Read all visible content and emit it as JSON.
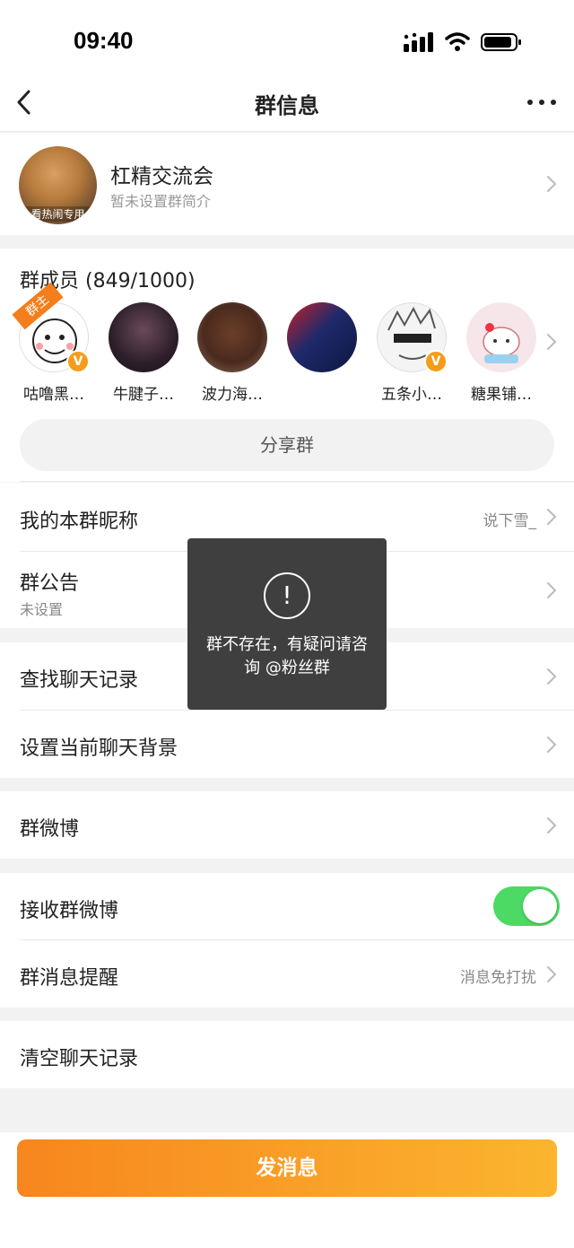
{
  "status_bar": {
    "time": "09:40"
  },
  "nav": {
    "title": "群信息"
  },
  "group": {
    "name": "杠精交流会",
    "description": "暂未设置群简介",
    "avatar_caption": "看热闹专用"
  },
  "members": {
    "title": "群成员 (849/1000)",
    "owner_tag": "群主",
    "list": [
      {
        "name": "咕噜黑…",
        "verified": true
      },
      {
        "name": "牛腱子…",
        "verified": false
      },
      {
        "name": "波力海…",
        "verified": false
      },
      {
        "name": "",
        "verified": false
      },
      {
        "name": "五条小…",
        "verified": true
      },
      {
        "name": "糖果铺…",
        "verified": false
      }
    ],
    "verified_badge": "V",
    "share_label": "分享群"
  },
  "rows": {
    "nickname": {
      "label": "我的本群昵称",
      "value": "说下雪_"
    },
    "notice": {
      "label": "群公告",
      "sub": "未设置"
    },
    "search_history": {
      "label": "查找聊天记录"
    },
    "background": {
      "label": "设置当前聊天背景"
    },
    "group_weibo": {
      "label": "群微博"
    },
    "receive_weibo": {
      "label": "接收群微博",
      "enabled": true
    },
    "reminder": {
      "label": "群消息提醒",
      "value": "消息免打扰"
    },
    "clear_history": {
      "label": "清空聊天记录"
    }
  },
  "toast": {
    "icon": "!",
    "message": "群不存在，有疑问请咨询 @粉丝群"
  },
  "send_button": {
    "label": "发消息"
  },
  "colors": {
    "accent": "#f7861e",
    "toggle_on": "#4cd964",
    "verified": "#f59c1a"
  }
}
